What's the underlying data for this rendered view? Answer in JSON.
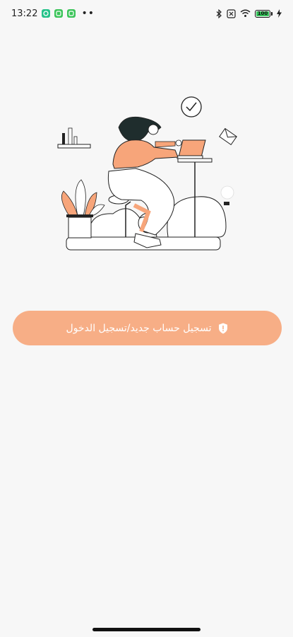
{
  "status_bar": {
    "time": "13:22",
    "notification_icons": [
      "app-icon",
      "app-icon",
      "app-icon"
    ],
    "more": "••",
    "battery_level": "100",
    "accent_green": "#36c35a"
  },
  "main": {
    "login_button_label": "تسجيل حساب جديد/تسجيل الدخول",
    "button_color": "#f7ae86",
    "illustration_accent": "#f7a57a"
  }
}
